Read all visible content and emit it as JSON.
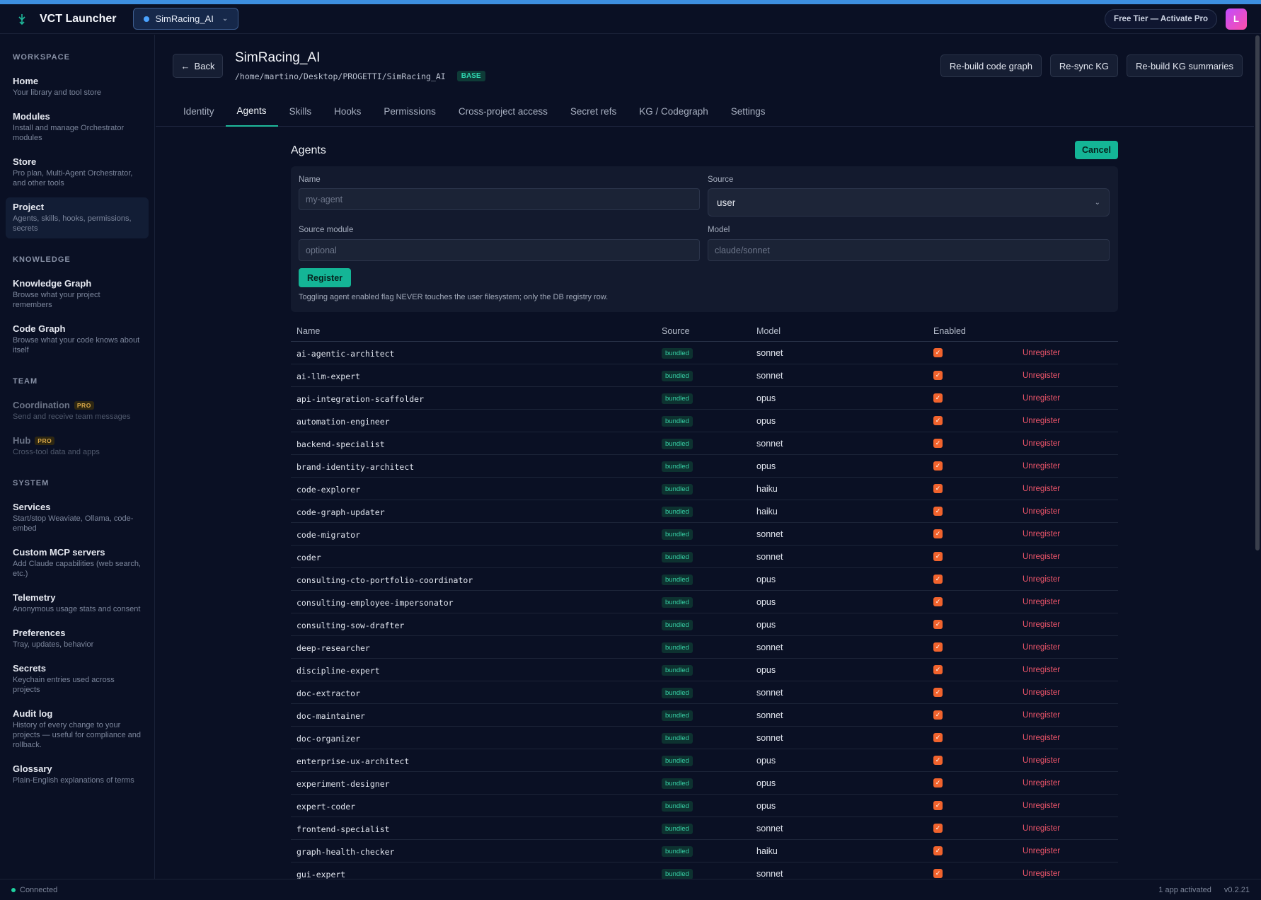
{
  "app": {
    "title": "VCT Launcher",
    "project_switch": "SimRacing_AI",
    "free_tier": "Free Tier — Activate Pro",
    "avatar": "L"
  },
  "sidebar": {
    "sections": [
      {
        "title": "WORKSPACE",
        "items": [
          {
            "label": "Home",
            "desc": "Your library and tool store"
          },
          {
            "label": "Modules",
            "desc": "Install and manage Orchestrator modules"
          },
          {
            "label": "Store",
            "desc": "Pro plan, Multi-Agent Orchestrator, and other tools"
          },
          {
            "label": "Project",
            "desc": "Agents, skills, hooks, permissions, secrets"
          }
        ]
      },
      {
        "title": "KNOWLEDGE",
        "items": [
          {
            "label": "Knowledge Graph",
            "desc": "Browse what your project remembers"
          },
          {
            "label": "Code Graph",
            "desc": "Browse what your code knows about itself"
          }
        ]
      },
      {
        "title": "TEAM",
        "items": [
          {
            "label": "Coordination",
            "badge": "PRO",
            "desc": "Send and receive team messages"
          },
          {
            "label": "Hub",
            "badge": "PRO",
            "desc": "Cross-tool data and apps"
          }
        ]
      },
      {
        "title": "SYSTEM",
        "items": [
          {
            "label": "Services",
            "desc": "Start/stop Weaviate, Ollama, code-embed"
          },
          {
            "label": "Custom MCP servers",
            "desc": "Add Claude capabilities (web search, etc.)"
          },
          {
            "label": "Telemetry",
            "desc": "Anonymous usage stats and consent"
          },
          {
            "label": "Preferences",
            "desc": "Tray, updates, behavior"
          },
          {
            "label": "Secrets",
            "desc": "Keychain entries used across projects"
          },
          {
            "label": "Audit log",
            "desc": "History of every change to your projects — useful for compliance and rollback."
          },
          {
            "label": "Glossary",
            "desc": "Plain-English explanations of terms"
          }
        ]
      }
    ]
  },
  "header": {
    "back": "Back",
    "title": "SimRacing_AI",
    "path": "/home/martino/Desktop/PROGETTI/SimRacing_AI",
    "badge": "BASE",
    "buttons": [
      "Re-build code graph",
      "Re-sync KG",
      "Re-build KG summaries"
    ]
  },
  "tabs": [
    "Identity",
    "Agents",
    "Skills",
    "Hooks",
    "Permissions",
    "Cross-project access",
    "Secret refs",
    "KG / Codegraph",
    "Settings"
  ],
  "panel": {
    "title": "Agents",
    "cancel": "Cancel",
    "form": {
      "name_label": "Name",
      "name_placeholder": "my-agent",
      "source_label": "Source",
      "source_value": "user",
      "module_label": "Source module",
      "module_placeholder": "optional",
      "model_label": "Model",
      "model_placeholder": "claude/sonnet",
      "register": "Register",
      "hint": "Toggling agent enabled flag NEVER touches the user filesystem; only the DB registry row."
    }
  },
  "table": {
    "columns": [
      "Name",
      "Source",
      "Model",
      "Enabled"
    ],
    "action_label": "Unregister",
    "rows": [
      {
        "name": "ai-agentic-architect",
        "source": "bundled",
        "model": "sonnet"
      },
      {
        "name": "ai-llm-expert",
        "source": "bundled",
        "model": "sonnet"
      },
      {
        "name": "api-integration-scaffolder",
        "source": "bundled",
        "model": "opus"
      },
      {
        "name": "automation-engineer",
        "source": "bundled",
        "model": "opus"
      },
      {
        "name": "backend-specialist",
        "source": "bundled",
        "model": "sonnet"
      },
      {
        "name": "brand-identity-architect",
        "source": "bundled",
        "model": "opus"
      },
      {
        "name": "code-explorer",
        "source": "bundled",
        "model": "haiku"
      },
      {
        "name": "code-graph-updater",
        "source": "bundled",
        "model": "haiku"
      },
      {
        "name": "code-migrator",
        "source": "bundled",
        "model": "sonnet"
      },
      {
        "name": "coder",
        "source": "bundled",
        "model": "sonnet"
      },
      {
        "name": "consulting-cto-portfolio-coordinator",
        "source": "bundled",
        "model": "opus"
      },
      {
        "name": "consulting-employee-impersonator",
        "source": "bundled",
        "model": "opus"
      },
      {
        "name": "consulting-sow-drafter",
        "source": "bundled",
        "model": "opus"
      },
      {
        "name": "deep-researcher",
        "source": "bundled",
        "model": "sonnet"
      },
      {
        "name": "discipline-expert",
        "source": "bundled",
        "model": "opus"
      },
      {
        "name": "doc-extractor",
        "source": "bundled",
        "model": "sonnet"
      },
      {
        "name": "doc-maintainer",
        "source": "bundled",
        "model": "sonnet"
      },
      {
        "name": "doc-organizer",
        "source": "bundled",
        "model": "sonnet"
      },
      {
        "name": "enterprise-ux-architect",
        "source": "bundled",
        "model": "opus"
      },
      {
        "name": "experiment-designer",
        "source": "bundled",
        "model": "opus"
      },
      {
        "name": "expert-coder",
        "source": "bundled",
        "model": "opus"
      },
      {
        "name": "frontend-specialist",
        "source": "bundled",
        "model": "sonnet"
      },
      {
        "name": "graph-health-checker",
        "source": "bundled",
        "model": "haiku"
      },
      {
        "name": "gui-expert",
        "source": "bundled",
        "model": "sonnet"
      }
    ]
  },
  "footer": {
    "status": "Connected",
    "apps": "1 app activated",
    "version": "v0.2.21"
  }
}
